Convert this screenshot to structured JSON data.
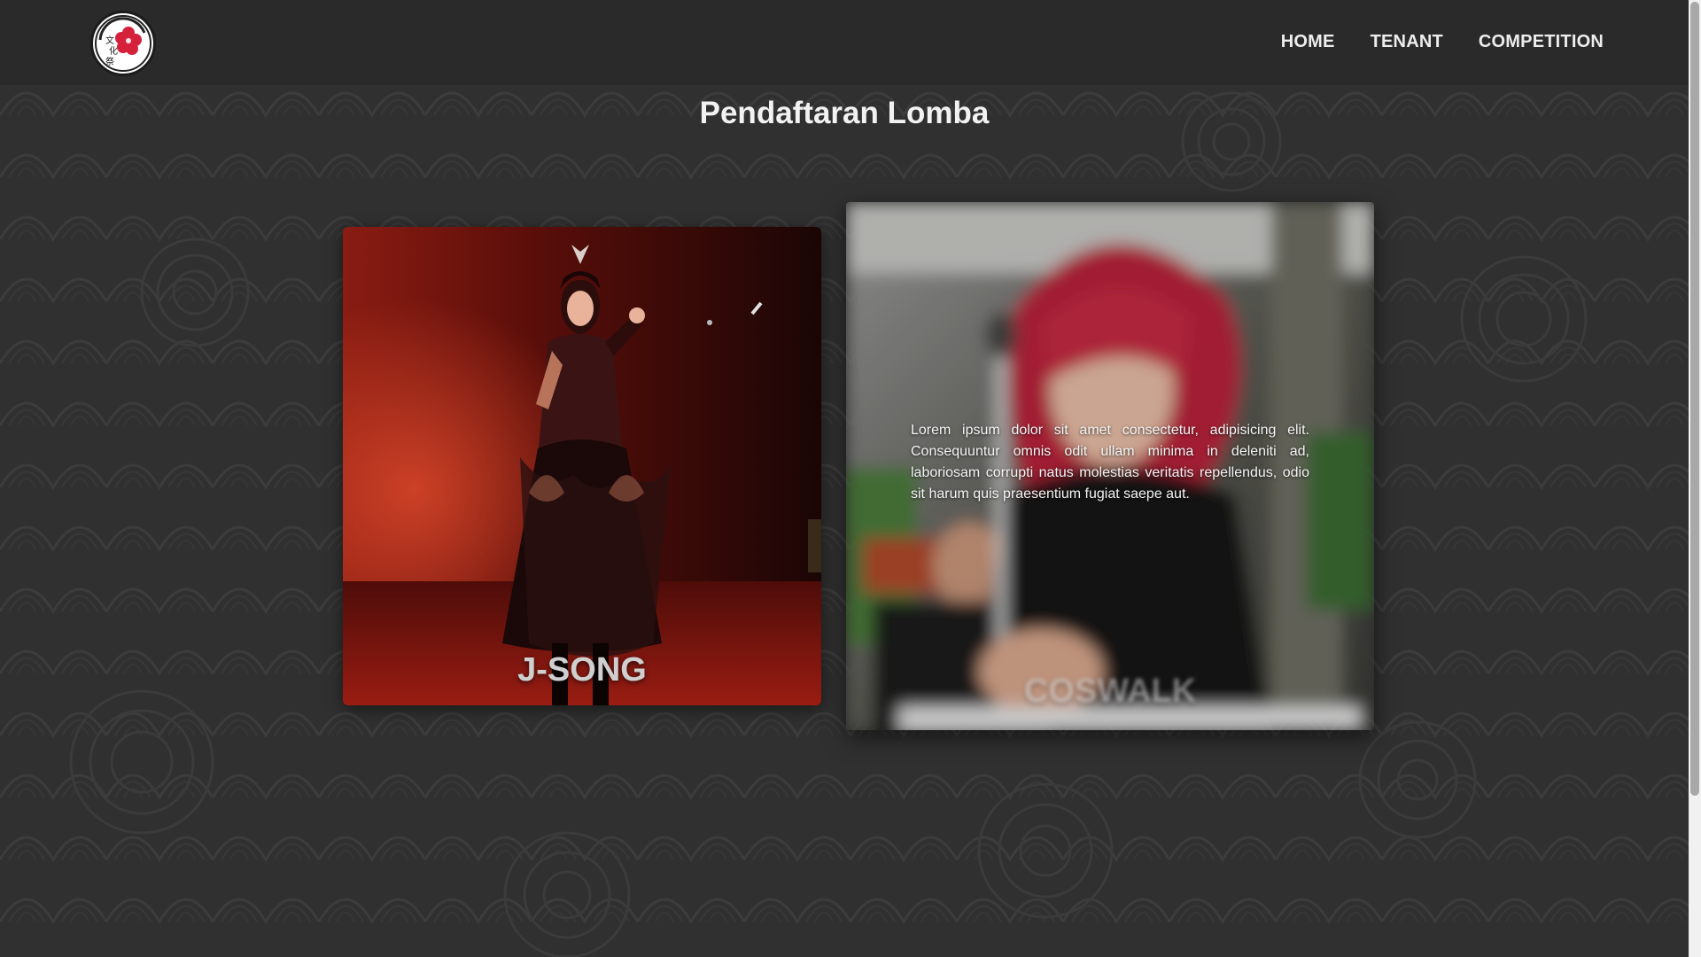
{
  "navbar": {
    "logo_icon": "sakura-festival-logo-icon",
    "links": [
      {
        "label": "HOME"
      },
      {
        "label": "TENANT"
      },
      {
        "label": "COMPETITION"
      }
    ]
  },
  "main": {
    "title": "Pendaftaran Lomba",
    "cards": [
      {
        "label": "J-SONG",
        "description": ""
      },
      {
        "label": "COSWALK",
        "description": "Lorem ipsum dolor sit amet consectetur, adipisicing elit. Consequuntur omnis odit ullam minima in deleniti ad, laboriosam corrupti natus molestias veritatis repellendus, odio sit harum quis praesentium fugiat saepe aut."
      }
    ]
  },
  "colors": {
    "background": "#303030",
    "navbar": "#2a2a2a",
    "text": "#ececec",
    "logo_accent": "#d6213b"
  }
}
